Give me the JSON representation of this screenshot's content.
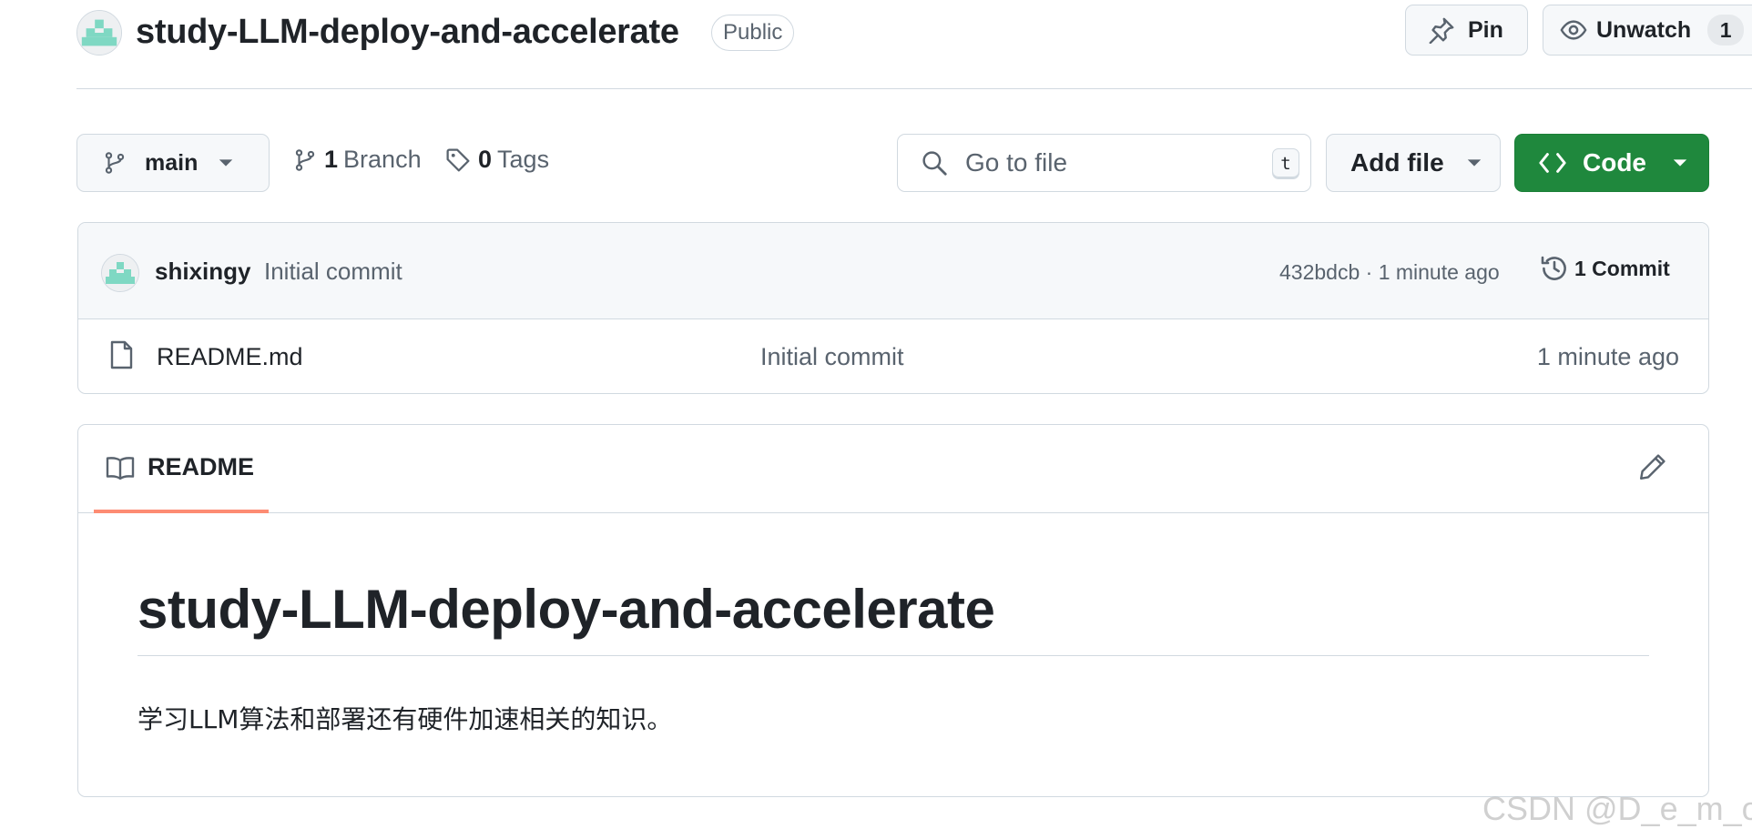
{
  "repo": {
    "name": "study-LLM-deploy-and-accelerate",
    "visibility": "Public",
    "actions": {
      "pin_label": "Pin",
      "unwatch_label": "Unwatch",
      "watch_count": "1"
    }
  },
  "toolbar": {
    "branch": "main",
    "branch_count": "1",
    "branch_label": "Branch",
    "tag_count": "0",
    "tag_label": "Tags",
    "search_placeholder": "Go to file",
    "search_shortcut": "t",
    "add_file_label": "Add file",
    "code_label": "Code"
  },
  "latest_commit": {
    "author": "shixingy",
    "message": "Initial commit",
    "meta": "432bdcb · 1 minute ago",
    "commit_count": "1 Commit"
  },
  "files": [
    {
      "name": "README.md",
      "message": "Initial commit",
      "age": "1 minute ago",
      "icon": "file-icon"
    }
  ],
  "readme": {
    "tab_label": "README",
    "heading": "study-LLM-deploy-and-accelerate",
    "body": "学习LLM算法和部署还有硬件加速相关的知识。"
  },
  "watermark": "CSDN @D_e_m_o",
  "colors": {
    "primary_button": "#1f883d",
    "tab_underline": "#fd8c73",
    "avatar_identicon": "#7fd8c3",
    "border": "#d1d9e0",
    "muted_text": "#59636e"
  }
}
